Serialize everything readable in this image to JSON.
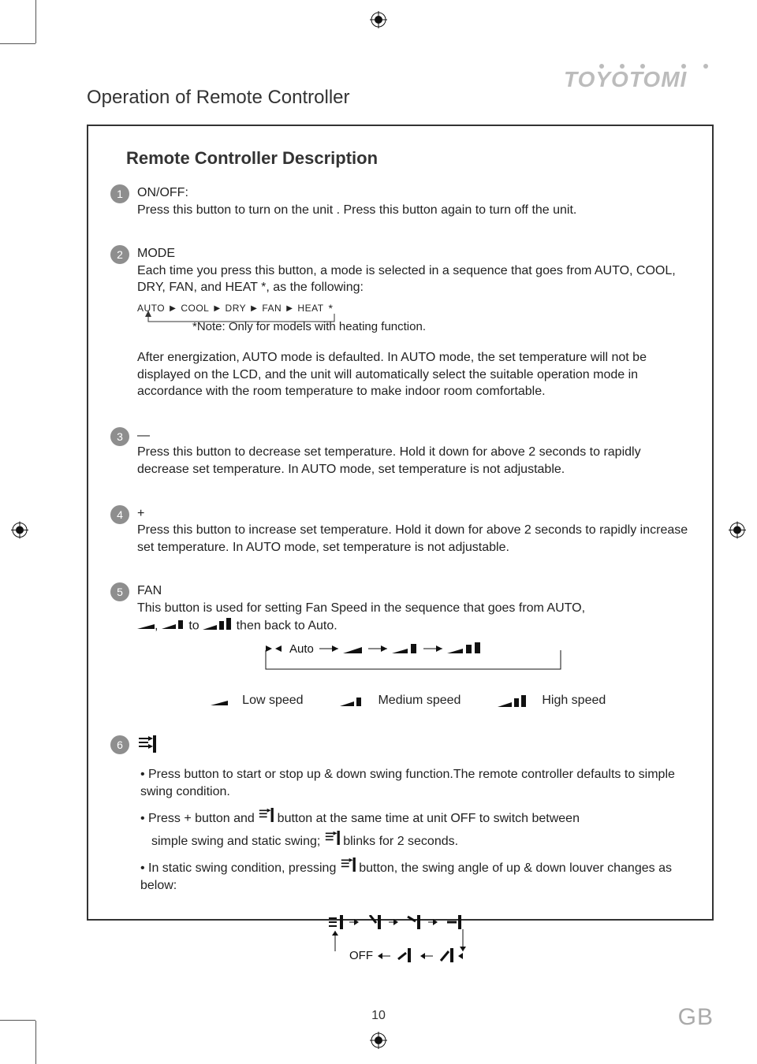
{
  "brand": "TOYOTOMI",
  "header": "Operation of Remote Controller",
  "section_title": "Remote Controller Description",
  "items": [
    {
      "num": "1",
      "label": "ON/OFF:",
      "body": "Press this button to turn on the unit . Press this button again to turn off the unit."
    },
    {
      "num": "2",
      "label": "MODE",
      "body": "Each time you press this button, a mode is selected in a sequence that goes from AUTO, COOL, DRY, FAN, and HEAT *, as the following:",
      "seq": [
        "AUTO",
        "COOL",
        "DRY",
        "FAN",
        "HEAT"
      ],
      "seq_star": "*",
      "note": "*Note: Only for models with heating function.",
      "after": "After energization, AUTO mode is defaulted. In AUTO mode, the set temperature will not be displayed on the LCD, and the unit will automatically select the suitable operation mode in accordance with the room temperature to make indoor room comfortable."
    },
    {
      "num": "3",
      "label": "—",
      "body": "Press this button to decrease set temperature. Hold it down for above 2 seconds to rapidly decrease set temperature. In AUTO mode, set temperature is not adjustable."
    },
    {
      "num": "4",
      "label": "+",
      "body": "Press this button to increase set temperature. Hold it down for above 2 seconds to rapidly increase set temperature. In AUTO mode, set temperature is not adjustable."
    },
    {
      "num": "5",
      "label": "FAN",
      "body_a": "This button is used for setting Fan Speed in the sequence that goes from AUTO,",
      "body_b": "to",
      "body_c": "then back to Auto.",
      "cycle_auto": "Auto",
      "legend": {
        "low": "Low speed",
        "med": "Medium speed",
        "high": "High speed"
      }
    },
    {
      "num": "6",
      "bullets": {
        "b1": "Press button to start or stop up & down swing function.The remote controller defaults to simple swing condition.",
        "b2a": "Press + button and",
        "b2b": "button at the same time at unit OFF to switch between",
        "b2c": "simple swing and static swing;",
        "b2d": "blinks for 2 seconds.",
        "b3a": "In static swing condition, pressing",
        "b3b": "button, the swing angle of up & down louver changes as below:"
      },
      "off_label": "OFF"
    }
  ],
  "page_number": "10",
  "lang": "GB"
}
